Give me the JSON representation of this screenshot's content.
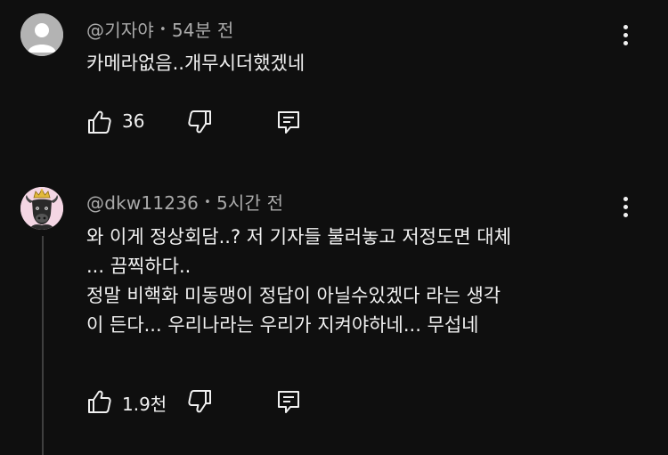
{
  "comments": [
    {
      "author": "@기자야",
      "time": "54분 전",
      "lines": [
        "카메라없음..개무시더했겠네"
      ],
      "likes": "36",
      "avatar_color": "#b3b3b3"
    },
    {
      "author": "@dkw11236",
      "time": "5시간 전",
      "lines": [
        "와 이게 정상회담..? 저 기자들 불러놓고 저정도면 대체",
        "... 끔찍하다..",
        "정말 비핵화 미동맹이 정답이 아닐수있겠다 라는 생각",
        "이 든다... 우리나라는 우리가 지켜야하네... 무섭네"
      ],
      "likes": "1.9천",
      "avatar_color": "#f4d6e4"
    }
  ],
  "icons": {
    "like": "thumb-up-icon",
    "dislike": "thumb-down-icon",
    "reply": "reply-comment-icon",
    "menu": "more-vert-icon"
  }
}
